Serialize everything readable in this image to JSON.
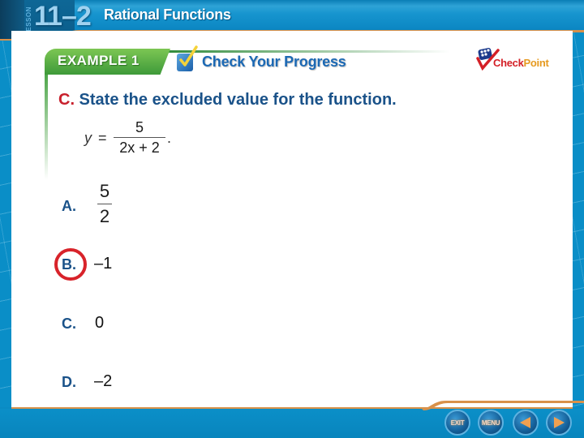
{
  "header": {
    "lesson_label": "LESSON",
    "lesson_number": "11–2",
    "lesson_title": "Rational Functions"
  },
  "banner": {
    "example_label": "EXAMPLE 1",
    "check_icon": "checkbox-check-icon",
    "progress_label": "Check Your Progress"
  },
  "logo": {
    "check": "Check",
    "point": "Point"
  },
  "question": {
    "letter": "C.",
    "text": " State the excluded value for the function.",
    "equation": {
      "lhs": "y",
      "equals": "=",
      "numerator": "5",
      "denominator": "2x + 2",
      "trailing": "."
    }
  },
  "answers": [
    {
      "letter": "A.",
      "numerator": "5",
      "denominator": "2",
      "selected": false
    },
    {
      "letter": "B.",
      "value": "–1",
      "selected": true
    },
    {
      "letter": "C.",
      "value": "0",
      "selected": false
    },
    {
      "letter": "D.",
      "value": "–2",
      "selected": false
    }
  ],
  "footer": {
    "exit_label": "EXIT",
    "menu_label": "MENU",
    "prev_icon": "triangle-left-icon",
    "next_icon": "triangle-right-icon"
  },
  "colors": {
    "header_blue": "#0b86c2",
    "question_blue": "#1a5289",
    "question_letter_red": "#c8202c",
    "selection_circle_red": "#d8232a",
    "example_green": "#3e9a3a",
    "progress_blue": "#1c69b4",
    "accent_orange": "#e69a20"
  }
}
